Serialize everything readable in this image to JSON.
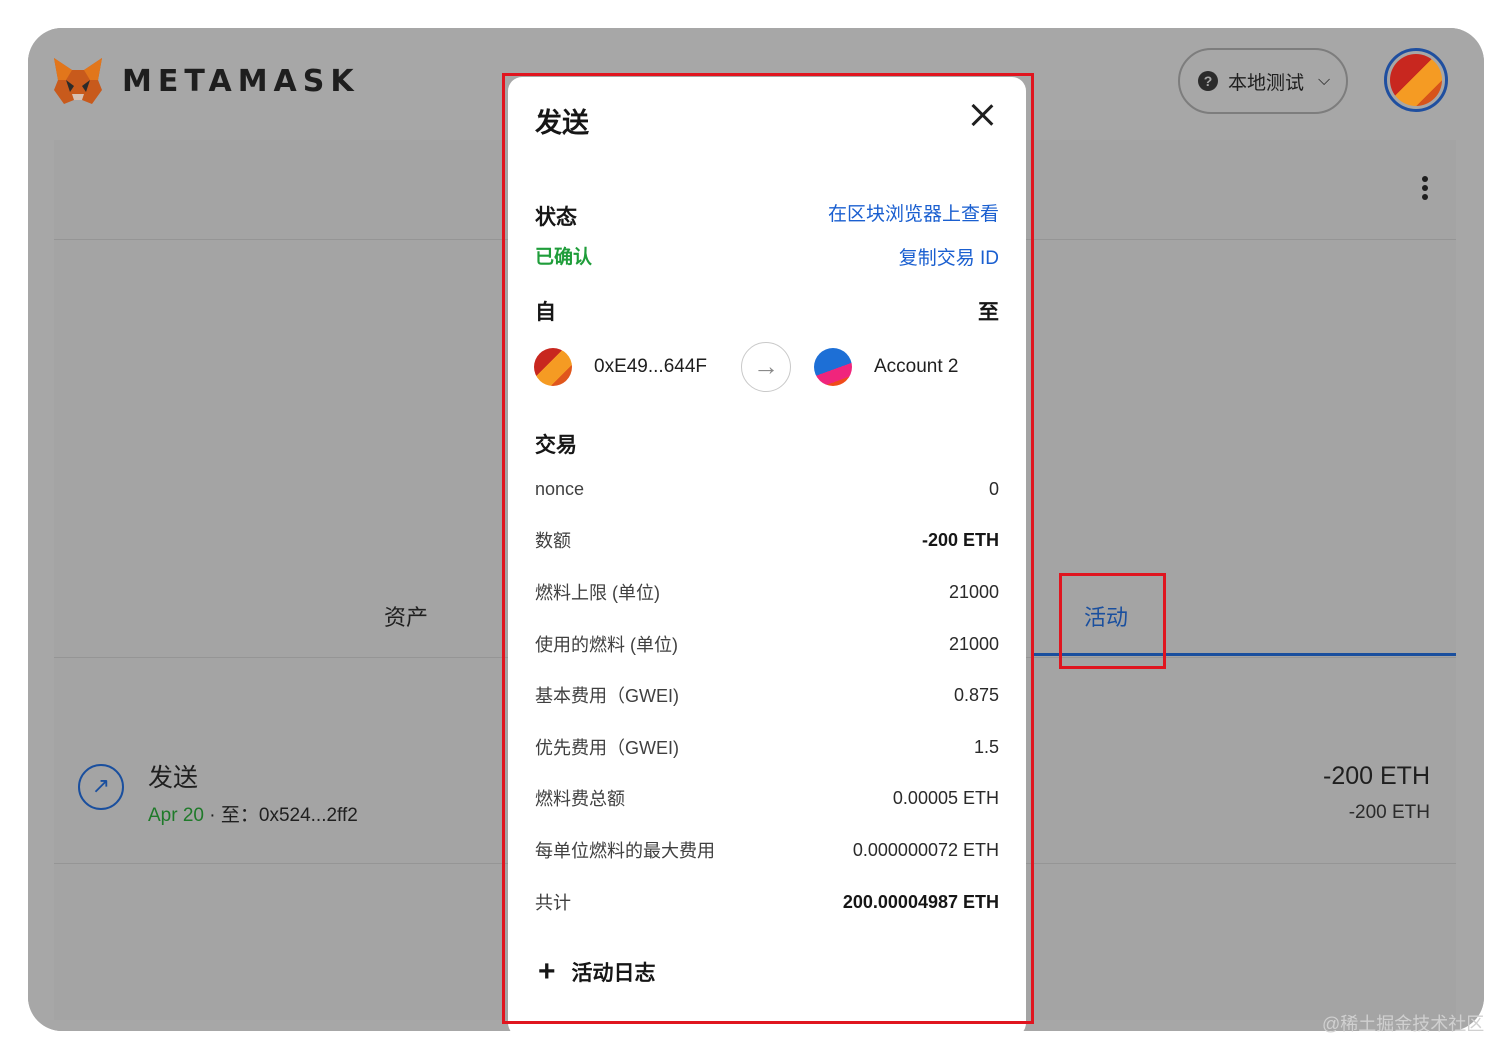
{
  "header": {
    "brand": "METAMASK",
    "network_label": "本地测试",
    "network_help_glyph": "?",
    "network_chevron_glyph": "⌵"
  },
  "tabs": {
    "assets": "资产",
    "activity": "活动"
  },
  "transaction_row": {
    "icon_glyph": "↗",
    "title": "发送",
    "date": "Apr 20",
    "separator": " · ",
    "to_prefix": "至：",
    "to_address": "0x524...2ff2",
    "amount": "-200 ETH",
    "amount_secondary": "-200 ETH"
  },
  "modal": {
    "title": "发送",
    "status_label": "状态",
    "status_value": "已确认",
    "view_on_explorer": "在区块浏览器上查看",
    "copy_tx_id": "复制交易 ID",
    "from_label": "自",
    "to_label": "至",
    "from_address": "0xE49...644F",
    "to_name": "Account 2",
    "arrow_glyph": "→",
    "transaction_section": "交易",
    "details": [
      {
        "label": "nonce",
        "value": "0",
        "bold": false
      },
      {
        "label": "数额",
        "value": "-200 ETH",
        "bold": true
      },
      {
        "label": "燃料上限 (单位)",
        "value": "21000",
        "bold": false
      },
      {
        "label": "使用的燃料 (单位)",
        "value": "21000",
        "bold": false
      },
      {
        "label": "基本费用（GWEI)",
        "value": "0.875",
        "bold": false
      },
      {
        "label": "优先费用（GWEI)",
        "value": "1.5",
        "bold": false
      },
      {
        "label": "燃料费总额",
        "value": "0.00005 ETH",
        "bold": false
      },
      {
        "label": "每单位燃料的最大费用",
        "value": "0.000000072 ETH",
        "bold": false
      },
      {
        "label": "共计",
        "value": "200.00004987 ETH",
        "bold": true
      }
    ],
    "activity_log_plus": "+",
    "activity_log": "活动日志"
  },
  "watermark": "@稀土掘金技术社区",
  "colors": {
    "accent_blue": "#1a5fd0",
    "tab_blue": "#1a4f9e",
    "confirmed_green": "#1f9d3a",
    "highlight_red": "#e0151f",
    "overlay_gray": "#a7a7a7"
  }
}
